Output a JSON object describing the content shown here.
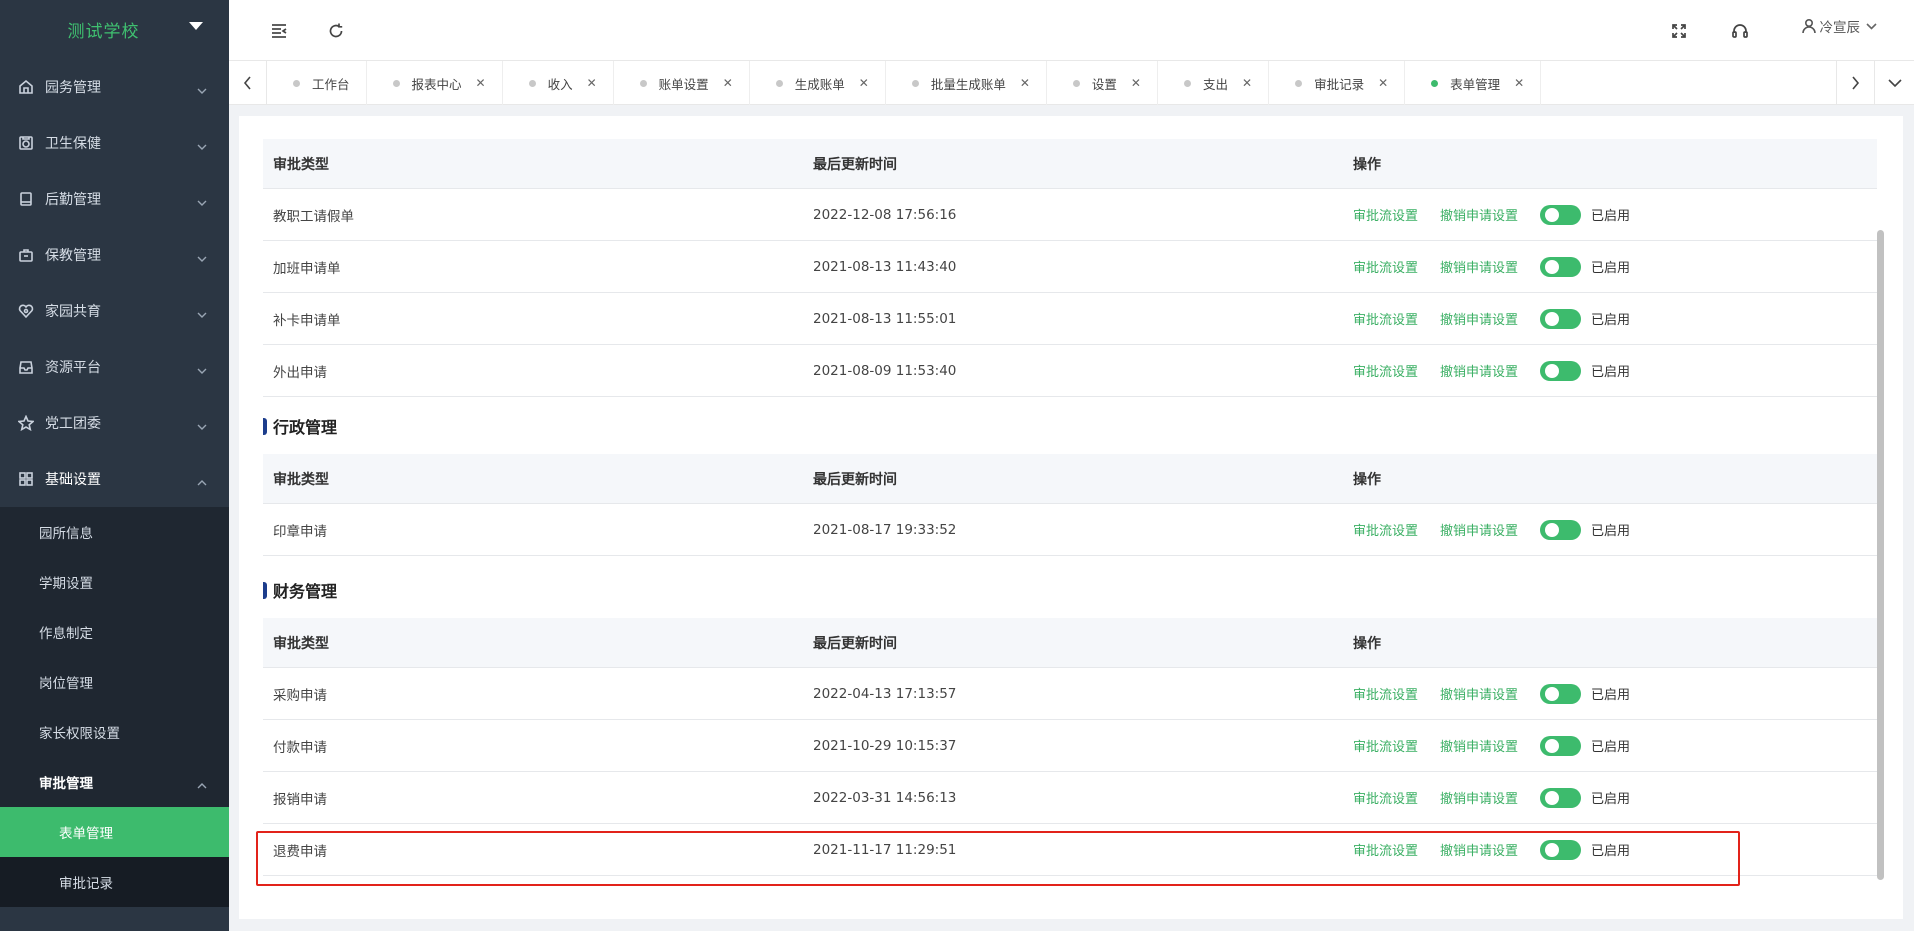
{
  "sidebar": {
    "school": "测试学校",
    "menu": [
      {
        "label": "园务管理",
        "icon": "home-icon"
      },
      {
        "label": "卫生保健",
        "icon": "health-icon"
      },
      {
        "label": "后勤管理",
        "icon": "logistics-icon"
      },
      {
        "label": "保教管理",
        "icon": "briefcase-icon"
      },
      {
        "label": "家园共育",
        "icon": "heart-icon"
      },
      {
        "label": "资源平台",
        "icon": "inbox-icon"
      },
      {
        "label": "党工团委",
        "icon": "star-icon"
      },
      {
        "label": "基础设置",
        "icon": "grid-icon"
      }
    ],
    "submenu": [
      "园所信息",
      "学期设置",
      "作息制定",
      "岗位管理",
      "家长权限设置",
      "审批管理"
    ],
    "subsub": [
      "表单管理",
      "审批记录"
    ]
  },
  "topbar": {
    "user": "冷宣辰"
  },
  "tabs": [
    {
      "label": "工作台",
      "closable": false
    },
    {
      "label": "报表中心",
      "closable": true
    },
    {
      "label": "收入",
      "closable": true
    },
    {
      "label": "账单设置",
      "closable": true
    },
    {
      "label": "生成账单",
      "closable": true
    },
    {
      "label": "批量生成账单",
      "closable": true
    },
    {
      "label": "设置",
      "closable": true
    },
    {
      "label": "支出",
      "closable": true
    },
    {
      "label": "审批记录",
      "closable": true
    },
    {
      "label": "表单管理",
      "closable": true,
      "active": true
    }
  ],
  "table_headers": {
    "type": "审批类型",
    "updated": "最后更新时间",
    "action": "操作"
  },
  "actions": {
    "flow": "审批流设置",
    "revoke": "撤销申请设置",
    "status": "已启用"
  },
  "sections": [
    {
      "title": "",
      "rows": [
        {
          "type": "教职工请假单",
          "updated": "2022-12-08 17:56:16"
        },
        {
          "type": "加班申请单",
          "updated": "2021-08-13 11:43:40"
        },
        {
          "type": "补卡申请单",
          "updated": "2021-08-13 11:55:01"
        },
        {
          "type": "外出申请",
          "updated": "2021-08-09 11:53:40"
        }
      ]
    },
    {
      "title": "行政管理",
      "rows": [
        {
          "type": "印章申请",
          "updated": "2021-08-17 19:33:52"
        }
      ]
    },
    {
      "title": "财务管理",
      "rows": [
        {
          "type": "采购申请",
          "updated": "2022-04-13 17:13:57"
        },
        {
          "type": "付款申请",
          "updated": "2021-10-29 10:15:37"
        },
        {
          "type": "报销申请",
          "updated": "2022-03-31 14:56:13"
        },
        {
          "type": "退费申请",
          "updated": "2021-11-17 11:29:51"
        }
      ]
    }
  ],
  "colors": {
    "accent": "#3dbb6d",
    "sidebar_bg": "#2b3643",
    "highlight": "#e2231a"
  }
}
